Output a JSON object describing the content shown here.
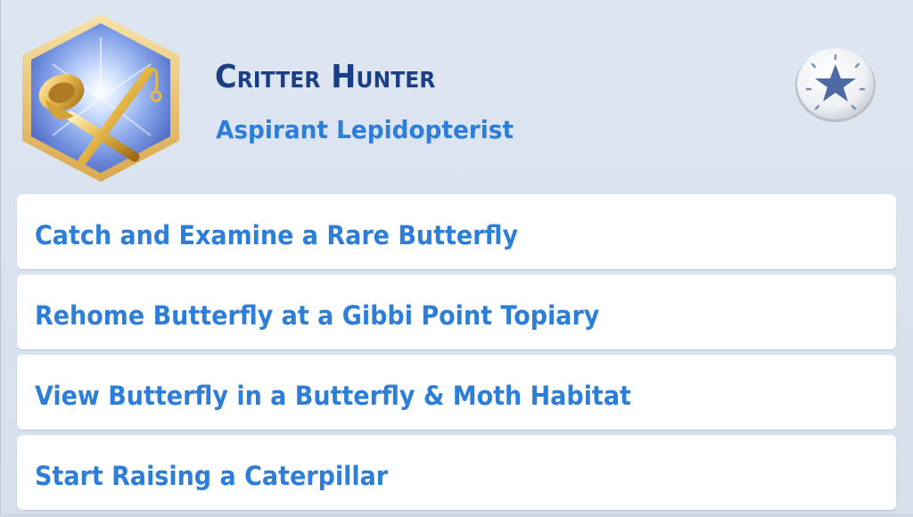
{
  "aspiration": {
    "title": "Critter Hunter",
    "subtitle": "Aspirant Lepidopterist",
    "badge_icon": "butterfly-net-and-fishing-rod-icon",
    "action_icon": "star-icon"
  },
  "goals": [
    {
      "label": "Catch and Examine a Rare Butterfly"
    },
    {
      "label": "Rehome Butterfly at a Gibbi Point Topiary"
    },
    {
      "label": "View Butterfly in a Butterfly & Moth Habitat"
    },
    {
      "label": "Start Raising a Caterpillar"
    }
  ],
  "colors": {
    "title": "#1b3f86",
    "goal_text": "#2d7ed8",
    "panel_bg": "#dde6f1",
    "badge_border": "#e6c27a"
  }
}
